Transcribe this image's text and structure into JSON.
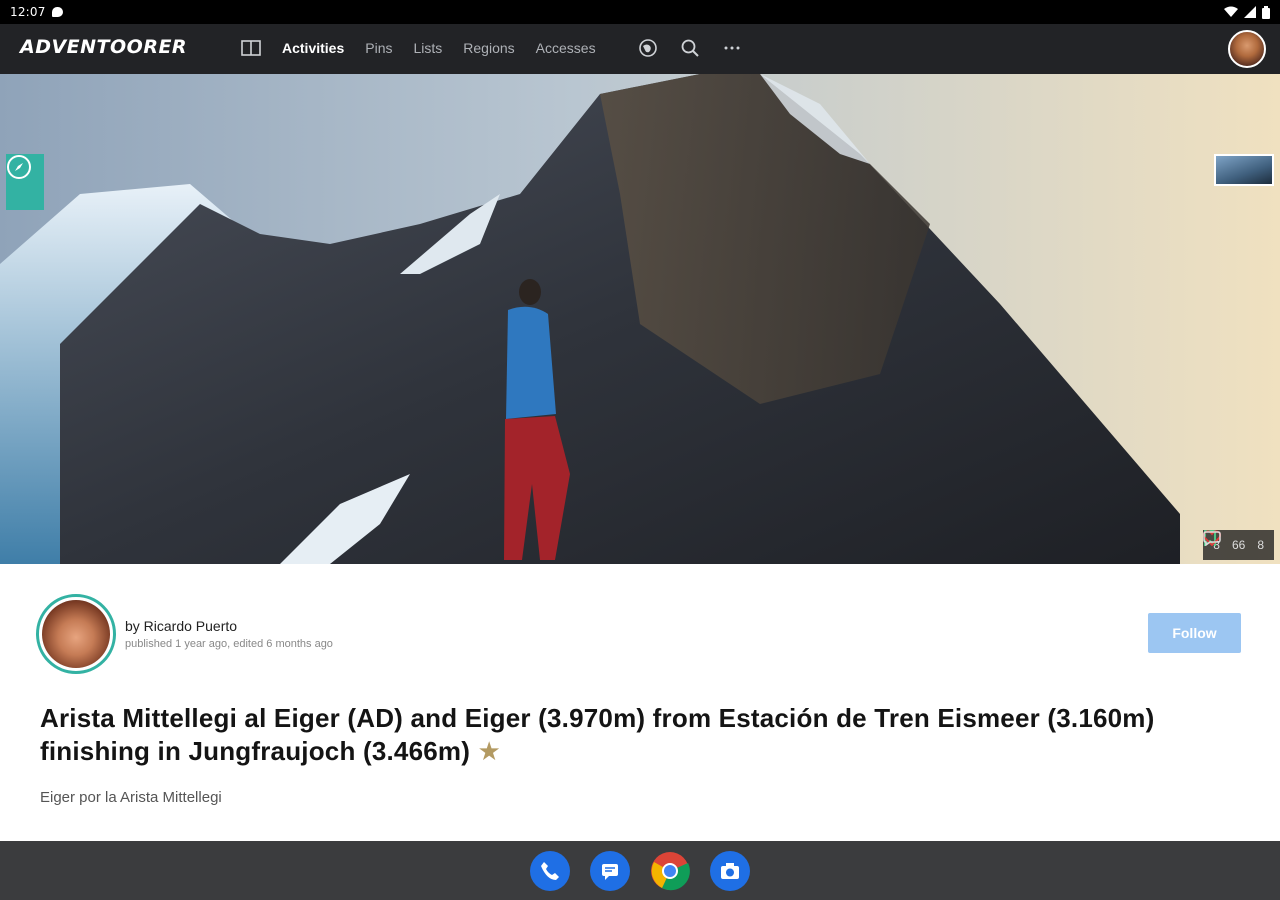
{
  "status_bar": {
    "time": "12:07"
  },
  "app": {
    "logo": "ADVENTOORER",
    "nav": [
      {
        "label": "Activities",
        "active": true
      },
      {
        "label": "Pins",
        "active": false
      },
      {
        "label": "Lists",
        "active": false
      },
      {
        "label": "Regions",
        "active": false
      },
      {
        "label": "Accesses",
        "active": false
      }
    ]
  },
  "hero": {
    "stats": {
      "saves": "8",
      "likes": "66",
      "comments": "8"
    }
  },
  "post": {
    "author_line": "by Ricardo Puerto",
    "meta": "published 1 year ago, edited 6 months ago",
    "follow_label": "Follow",
    "title": "Arista Mittellegi al Eiger (AD) and Eiger (3.970m) from Estación de Tren Eismeer (3.160m) finishing in Jungfraujoch (3.466m)",
    "title_star": "★",
    "subtitle": "Eiger por la Arista Mittellegi"
  },
  "colors": {
    "accent": "#33b2a3",
    "follow": "#9cc6f2",
    "header": "#222326"
  },
  "dock": [
    "phone-icon",
    "messages-icon",
    "chrome-icon",
    "camera-icon"
  ]
}
